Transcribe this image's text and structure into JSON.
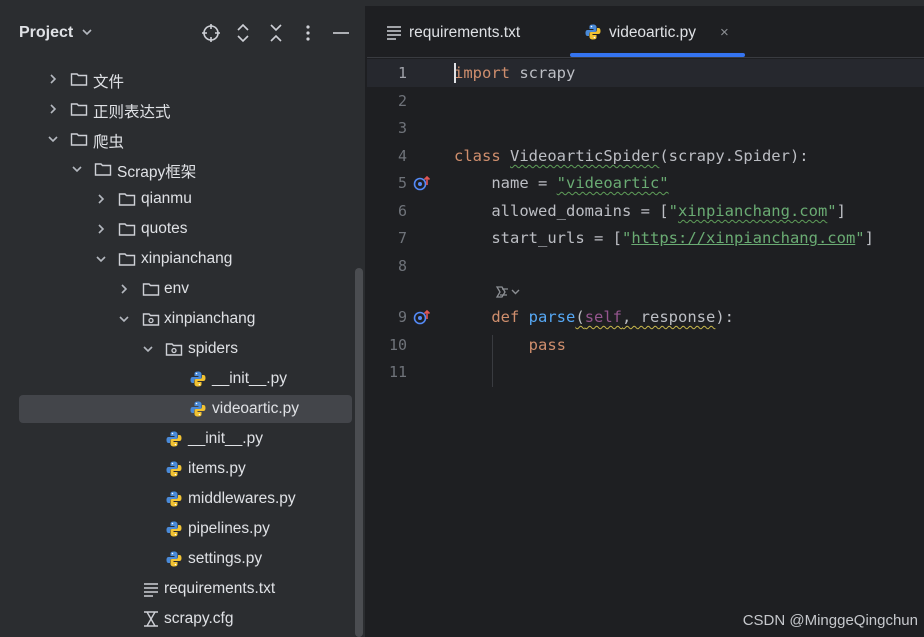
{
  "colors": {
    "panel_bg": "#2b2d30",
    "editor_bg": "#1e1f22",
    "selection": "#43454a",
    "accent": "#3574f0",
    "keyword": "#cf8e6d",
    "string": "#6aab73",
    "function": "#56a8f5",
    "self": "#94558d",
    "text": "#bcbec4"
  },
  "project_panel": {
    "title": "Project",
    "header_icons": [
      "locate-icon",
      "expand-collapse-icon",
      "collapse-all-icon",
      "more-options-icon",
      "hide-panel-icon"
    ],
    "tree": [
      {
        "label": "文件",
        "type": "folder",
        "level": 1,
        "expanded": false
      },
      {
        "label": "正则表达式",
        "type": "folder",
        "level": 1,
        "expanded": false
      },
      {
        "label": "爬虫",
        "type": "folder",
        "level": 1,
        "expanded": true
      },
      {
        "label": "Scrapy框架",
        "type": "folder",
        "level": 2,
        "expanded": true
      },
      {
        "label": "qianmu",
        "type": "folder",
        "level": 3,
        "expanded": false
      },
      {
        "label": "quotes",
        "type": "folder",
        "level": 3,
        "expanded": false
      },
      {
        "label": "xinpianchang",
        "type": "folder",
        "level": 3,
        "expanded": true
      },
      {
        "label": "env",
        "type": "folder",
        "level": 4,
        "expanded": false
      },
      {
        "label": "xinpianchang",
        "type": "package",
        "level": 4,
        "expanded": true
      },
      {
        "label": "spiders",
        "type": "package",
        "level": 5,
        "expanded": true
      },
      {
        "label": "__init__.py",
        "type": "python",
        "level": 6
      },
      {
        "label": "videoartic.py",
        "type": "python",
        "level": 6,
        "selected": true
      },
      {
        "label": "__init__.py",
        "type": "python",
        "level": 5
      },
      {
        "label": "items.py",
        "type": "python",
        "level": 5
      },
      {
        "label": "middlewares.py",
        "type": "python",
        "level": 5
      },
      {
        "label": "pipelines.py",
        "type": "python",
        "level": 5
      },
      {
        "label": "settings.py",
        "type": "python",
        "level": 5
      },
      {
        "label": "requirements.txt",
        "type": "text",
        "level": 4
      },
      {
        "label": "scrapy.cfg",
        "type": "config",
        "level": 4
      }
    ]
  },
  "editor": {
    "tabs": [
      {
        "label": "requirements.txt",
        "icon": "text-file-icon",
        "active": false
      },
      {
        "label": "videoartic.py",
        "icon": "python-file-icon",
        "active": true,
        "close": "×"
      }
    ],
    "line_numbers": [
      "1",
      "2",
      "3",
      "4",
      "5",
      "6",
      "7",
      "8",
      "9",
      "10",
      "11"
    ],
    "code": {
      "l1_kw": "import",
      "l1_rest": " scrapy",
      "l4_kw": "class",
      "l4_name": "VideoarticSpider",
      "l4_rest": "(scrapy.Spider):",
      "l5_pre": "    name = ",
      "l5_str": "\"videoartic\"",
      "l6_pre": "    allowed_domains = [",
      "l6_q1": "\"",
      "l6_str": "xinpianchang.com",
      "l6_q2": "\"",
      "l6_post": "]",
      "l7_pre": "    start_urls = [",
      "l7_q1": "\"",
      "l7_str": "https://xinpianchang.com",
      "l7_q2": "\"",
      "l7_post": "]",
      "l9_kw": "def",
      "l9_fn": "parse",
      "l9_open": "(",
      "l9_self": "self",
      "l9_args": ", response",
      "l9_close": "):",
      "l10_kw": "pass"
    }
  },
  "watermark": "CSDN @MinggeQingchun"
}
